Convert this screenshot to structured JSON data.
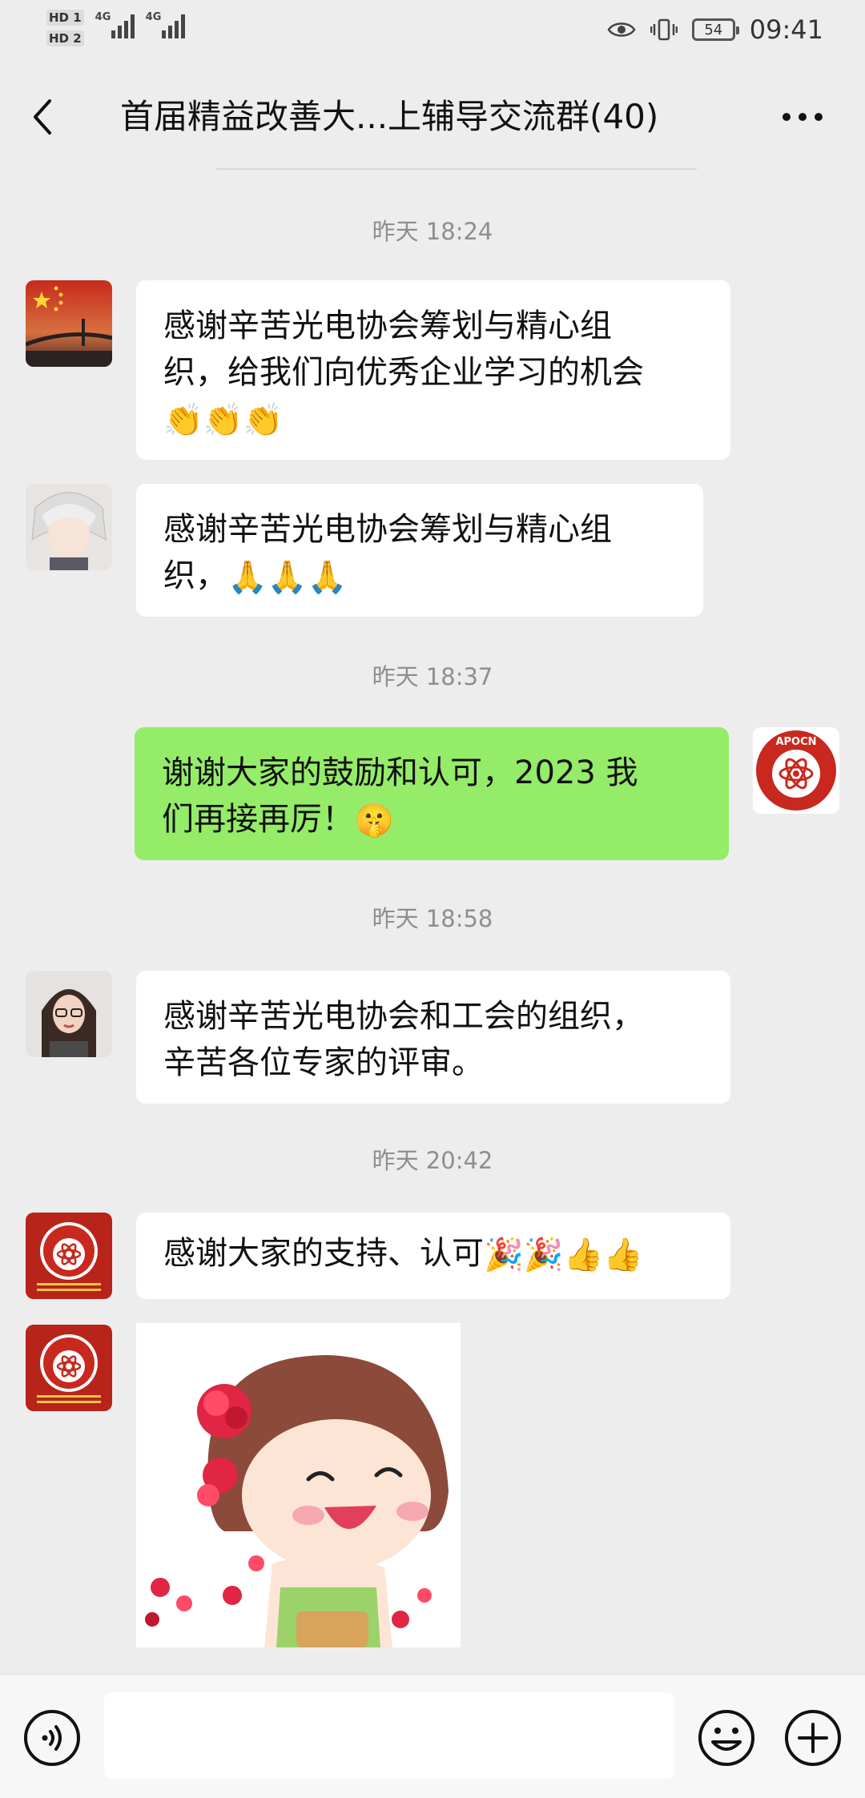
{
  "status_bar": {
    "hd1": "HD 1",
    "hd2": "HD 2",
    "net1": "4G",
    "net2": "4G",
    "battery": "54",
    "time": "09:41",
    "icons": [
      "eye-icon",
      "vibrate-icon",
      "battery-icon"
    ]
  },
  "header": {
    "title": "首届精益改善大...上辅导交流群(40)",
    "back_icon": "back-chevron-icon",
    "more_icon": "more-dots-icon"
  },
  "messages": {
    "t1": "昨天 18:24",
    "m1": "感谢辛苦光电协会筹划与精心组\n织，给我们向优秀企业学习的机会",
    "m1_emoji": "👏👏👏",
    "m2": "感谢辛苦光电协会筹划与精心组\n织，",
    "m2_emoji": "🙏🙏🙏",
    "t2": "昨天 18:37",
    "m3": "谢谢大家的鼓励和认可，2023 我\n们再接再厉！",
    "m3_emoji": "🤫",
    "t3": "昨天 18:58",
    "m4": "感谢辛苦光电协会和工会的组织，\n辛苦各位专家的评审。",
    "t4": "昨天 20:42",
    "m5": "感谢大家的支持、认可",
    "m5_emoji": "🎉🎉👍👍",
    "avatar_logo_text": "APOCN"
  },
  "input": {
    "placeholder": ""
  },
  "colors": {
    "background": "#ededed",
    "bubble_self": "#95ec69",
    "bubble_other": "#ffffff",
    "logo_red": "#c8281e"
  }
}
